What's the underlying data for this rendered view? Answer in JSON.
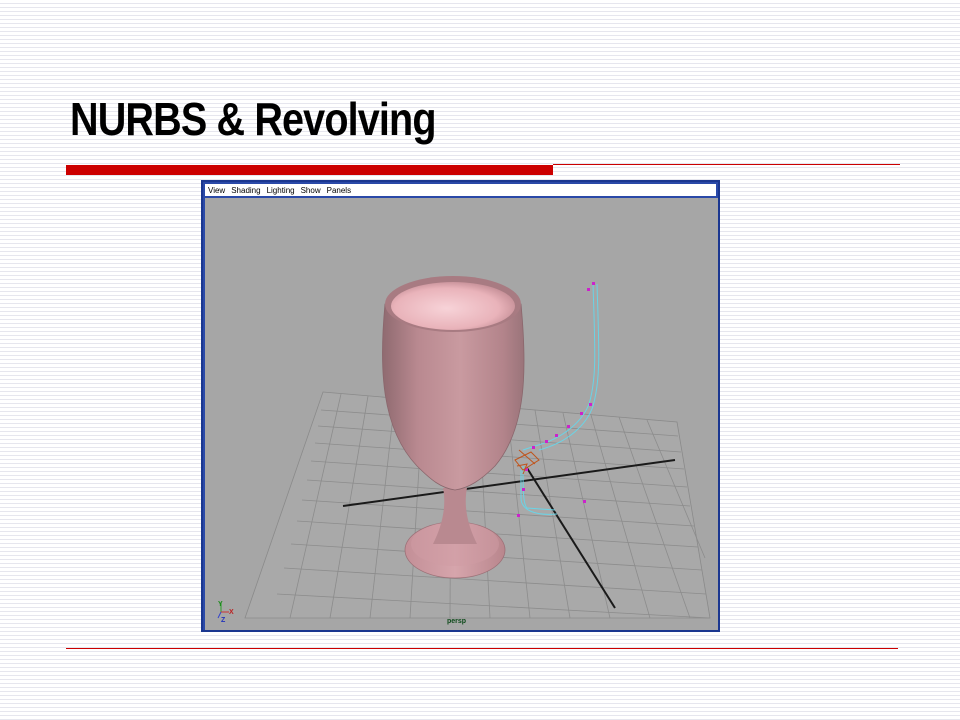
{
  "slide": {
    "title": "NURBS & Revolving"
  },
  "viewport": {
    "menu": [
      "View",
      "Shading",
      "Lighting",
      "Show",
      "Panels"
    ],
    "camera_label": "persp",
    "axis_labels": {
      "y": "Y",
      "x": "X",
      "z": "Z"
    }
  },
  "colors": {
    "accent_rule": "#cc0000",
    "viewport_background": "#a6a6a6",
    "window_frame": "#2a49a8",
    "object_surface": "#c9959c",
    "curve": "#6ad4e6",
    "control_points": "#cc22cc"
  }
}
